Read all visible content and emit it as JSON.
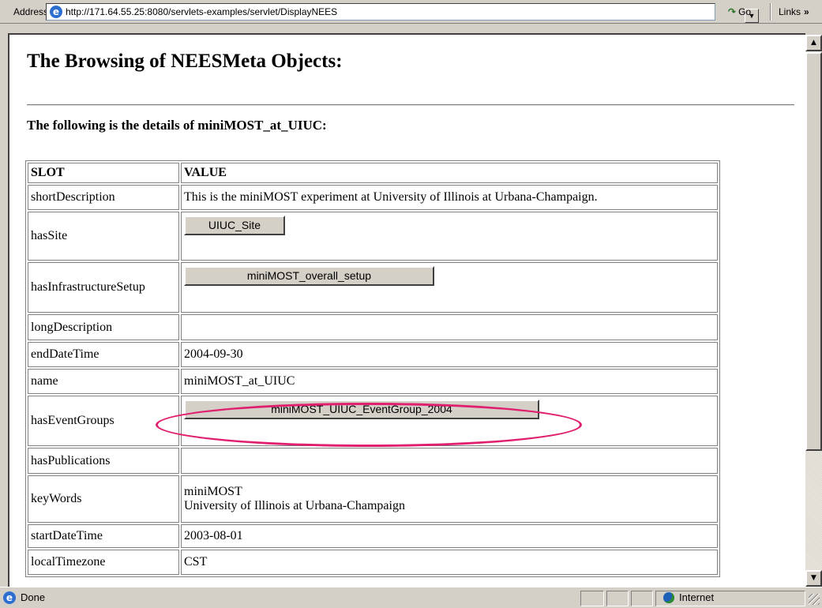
{
  "addressbar": {
    "label": "Address",
    "url": "http://171.64.55.25:8080/servlets-examples/servlet/DisplayNEES",
    "go_label": "Go",
    "links_label": "Links"
  },
  "page": {
    "title": "The Browsing of NEESMeta Objects:",
    "subheading": "The following is the details of miniMOST_at_UIUC:",
    "table": {
      "header": {
        "slot": "SLOT",
        "value": "VALUE"
      },
      "rows": [
        {
          "slot": "shortDescription",
          "value": "This is the miniMOST experiment at University of Illinois at Urbana-Champaign."
        },
        {
          "slot": "hasSite",
          "button": "UIUC_Site"
        },
        {
          "slot": "hasInfrastructureSetup",
          "button": "miniMOST_overall_setup"
        },
        {
          "slot": "longDescription",
          "value": ""
        },
        {
          "slot": "endDateTime",
          "value": "2004-09-30"
        },
        {
          "slot": "name",
          "value": "miniMOST_at_UIUC"
        },
        {
          "slot": "hasEventGroups",
          "button": "miniMOST_UIUC_EventGroup_2004"
        },
        {
          "slot": "hasPublications",
          "value": ""
        },
        {
          "slot": "keyWords",
          "value_line1": "miniMOST",
          "value_line2": "University of Illinois at Urbana-Champaign"
        },
        {
          "slot": "startDateTime",
          "value": "2003-08-01"
        },
        {
          "slot": "localTimezone",
          "value": "CST"
        }
      ]
    },
    "highlight_color": "#e0206f"
  },
  "statusbar": {
    "status": "Done",
    "zone": "Internet"
  }
}
